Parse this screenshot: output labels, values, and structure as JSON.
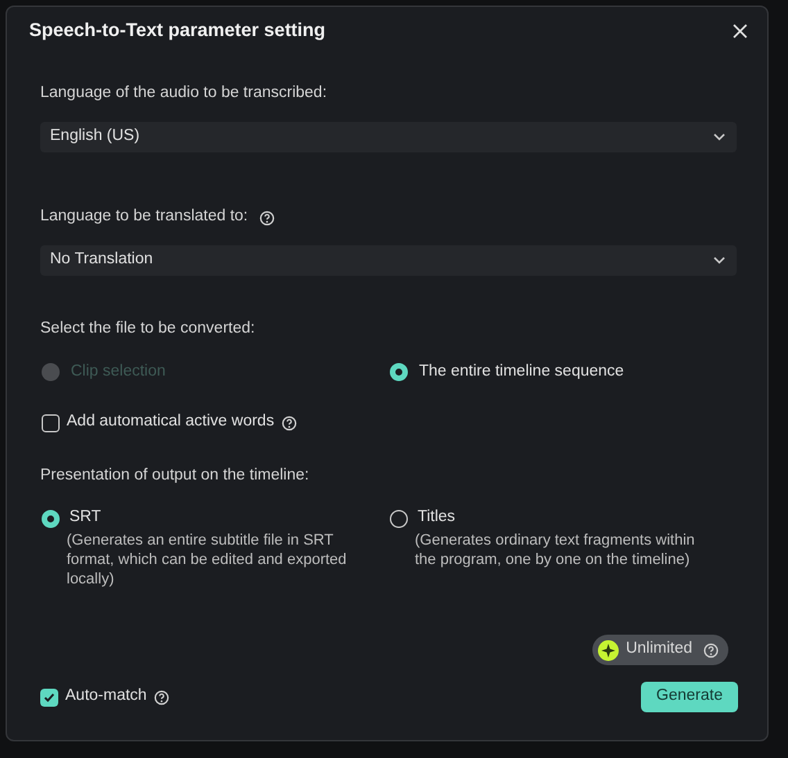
{
  "dialog": {
    "title": "Speech-to-Text parameter setting"
  },
  "source_language": {
    "label": "Language of the audio to be transcribed:",
    "value": "English (US)"
  },
  "translation_language": {
    "label": "Language to be translated to:",
    "value": "No Translation"
  },
  "file_selection": {
    "label": "Select the file to be converted:",
    "options": [
      {
        "label": "Clip selection",
        "selected": false,
        "disabled": true
      },
      {
        "label": "The entire timeline sequence",
        "selected": true,
        "disabled": false
      }
    ]
  },
  "active_words": {
    "label": "Add automatical active words",
    "checked": false
  },
  "presentation": {
    "label": "Presentation of output on the timeline:",
    "options": [
      {
        "label": "SRT",
        "description": "(Generates an entire subtitle file in SRT format, which can be edited and exported locally)",
        "selected": true
      },
      {
        "label": "Titles",
        "description": "(Generates ordinary text fragments within the program, one by one on the timeline)",
        "selected": false
      }
    ]
  },
  "quota": {
    "label": "Unlimited"
  },
  "auto_match": {
    "label": "Auto-match",
    "checked": true
  },
  "generate_button": "Generate"
}
